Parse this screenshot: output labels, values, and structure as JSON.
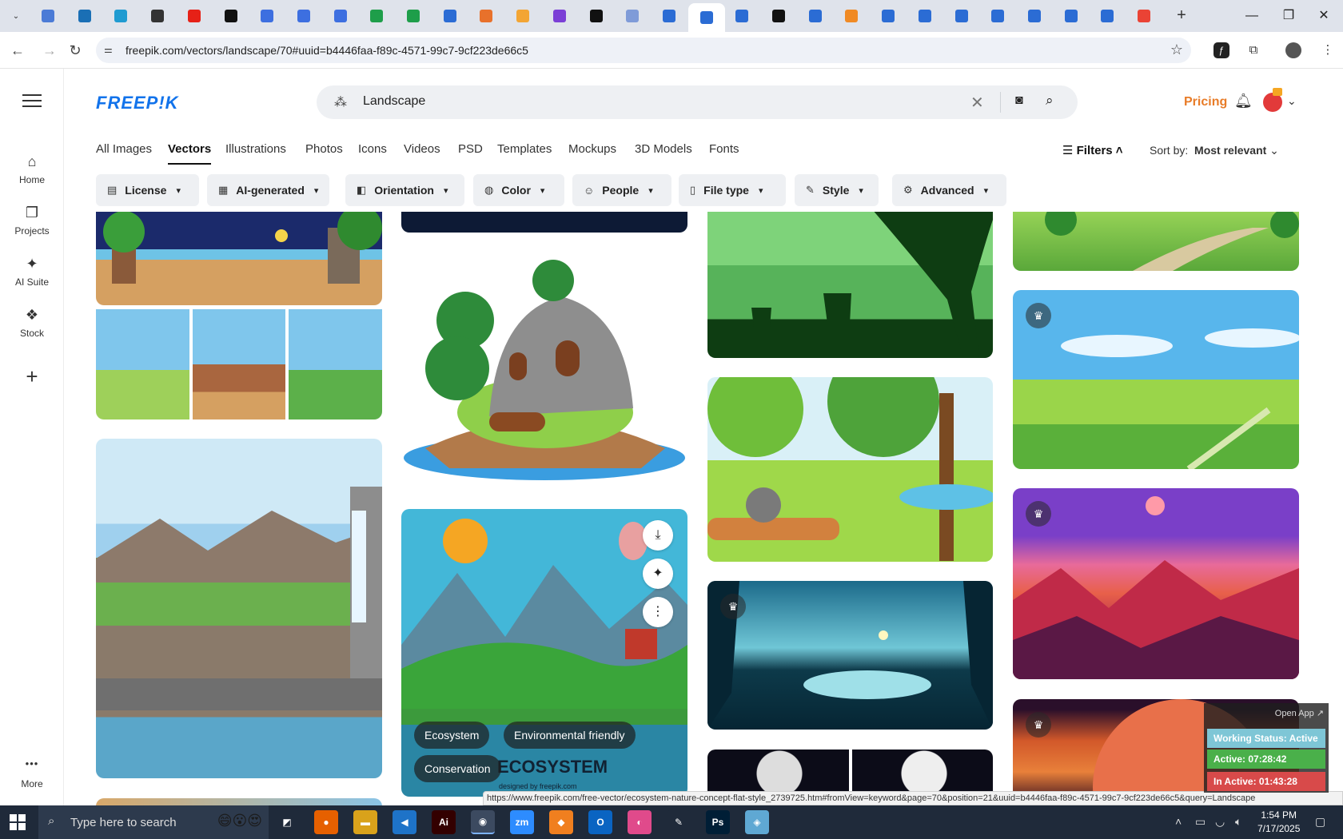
{
  "browser": {
    "url": "freepik.com/vectors/landscape/70#uuid=b4446faa-f89c-4571-99c7-9cf223de66c5",
    "new_tab": "+",
    "tab_menu": "⌄",
    "tabs": [
      {
        "color": "#4b7bd6"
      },
      {
        "color": "#1a6fb5"
      },
      {
        "color": "#1f9bd1"
      },
      {
        "color": "#333333"
      },
      {
        "color": "#e62117"
      },
      {
        "color": "#111111"
      },
      {
        "color": "#3d6fe0"
      },
      {
        "color": "#3d6fe0"
      },
      {
        "color": "#3d6fe0"
      },
      {
        "color": "#1e9e4a"
      },
      {
        "color": "#1e9e4a"
      },
      {
        "color": "#2b6cd4"
      },
      {
        "color": "#e8712b"
      },
      {
        "color": "#f3a534"
      },
      {
        "color": "#7b3fd6"
      },
      {
        "color": "#111111"
      },
      {
        "color": "#7f9bd8"
      },
      {
        "color": "#2b6cd4"
      },
      {
        "color": "#2b6cd4",
        "active": true
      },
      {
        "color": "#2b6cd4"
      },
      {
        "color": "#111111"
      },
      {
        "color": "#2b6cd4"
      },
      {
        "color": "#f08a24"
      },
      {
        "color": "#2b6cd4"
      },
      {
        "color": "#2b6cd4"
      },
      {
        "color": "#2b6cd4"
      },
      {
        "color": "#2b6cd4"
      },
      {
        "color": "#2b6cd4"
      },
      {
        "color": "#2b6cd4"
      },
      {
        "color": "#2b6cd4"
      },
      {
        "color": "#ea4335"
      }
    ]
  },
  "rail": {
    "items": [
      {
        "label": "Home",
        "icon": "⌂"
      },
      {
        "label": "Projects",
        "icon": "❐"
      },
      {
        "label": "AI Suite",
        "icon": "✦"
      },
      {
        "label": "Stock",
        "icon": "❖"
      }
    ],
    "add": "+",
    "more": {
      "label": "More",
      "icon": "•••"
    }
  },
  "header": {
    "logo": "FREEP!K",
    "search_value": "Landscape",
    "pricing": "Pricing"
  },
  "categories": [
    {
      "label": "All Images",
      "active": false
    },
    {
      "label": "Vectors",
      "active": true
    },
    {
      "label": "Illustrations",
      "active": false
    },
    {
      "label": "Photos",
      "active": false
    },
    {
      "label": "Icons",
      "active": false
    },
    {
      "label": "Videos",
      "active": false
    },
    {
      "label": "PSD",
      "active": false
    },
    {
      "label": "Templates",
      "active": false
    },
    {
      "label": "Mockups",
      "active": false
    },
    {
      "label": "3D Models",
      "active": false
    },
    {
      "label": "Fonts",
      "active": false
    }
  ],
  "filters": {
    "label": "Filters",
    "sort_label": "Sort by:",
    "sort_value": "Most relevant",
    "chips": [
      {
        "label": "License",
        "icon": "▤"
      },
      {
        "label": "AI-generated",
        "icon": "▦"
      },
      {
        "label": "Orientation",
        "icon": "◧"
      },
      {
        "label": "Color",
        "icon": "◍"
      },
      {
        "label": "People",
        "icon": "☺"
      },
      {
        "label": "File type",
        "icon": "▯"
      },
      {
        "label": "Style",
        "icon": "✎"
      },
      {
        "label": "Advanced",
        "icon": "⚙"
      }
    ]
  },
  "hovered_card": {
    "tags": [
      "Ecosystem",
      "Environmental friendly",
      "Conservation"
    ],
    "caption": "ECOSYSTEM",
    "credit": "designed by freepik.com"
  },
  "status_url": "https://www.freepik.com/free-vector/ecosystem-nature-concept-flat-style_2739725.htm#fromView=keyword&page=70&position=21&uuid=b4446faa-f89c-4571-99c7-9cf223de66c5&query=Landscape",
  "tracker": {
    "open_app": "Open App ↗",
    "working_status": "Working Status: Active",
    "active": "Active: 07:28:42",
    "inactive": "In Active: 01:43:28"
  },
  "taskbar": {
    "search_placeholder": "Type here to search",
    "time": "1:54 PM",
    "date": "7/17/2025",
    "apps": [
      {
        "label": "◩",
        "color": "#1f2a3a"
      },
      {
        "label": "●",
        "color": "#e66000"
      },
      {
        "label": "▬",
        "color": "#d9a21b"
      },
      {
        "label": "◀",
        "color": "#1e73c8"
      },
      {
        "label": "Ai",
        "color": "#330000"
      },
      {
        "label": "◉",
        "color": "#3c4a60"
      },
      {
        "label": "zm",
        "color": "#2d8cff"
      },
      {
        "label": "◆",
        "color": "#f07f1f"
      },
      {
        "label": "O",
        "color": "#0a64c2"
      },
      {
        "label": "◐",
        "color": "#e04a8b"
      },
      {
        "label": "✎",
        "color": "#1f2a3a"
      },
      {
        "label": "Ps",
        "color": "#001e36"
      },
      {
        "label": "◈",
        "color": "#5fa8d3"
      }
    ]
  }
}
